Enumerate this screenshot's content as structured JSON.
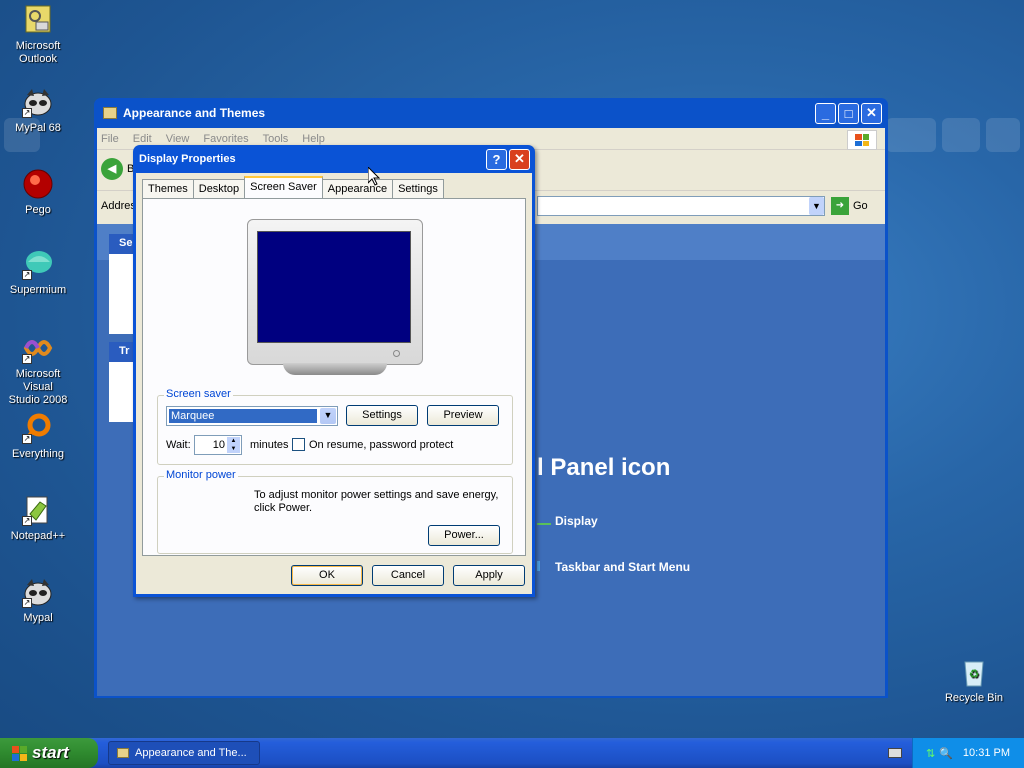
{
  "desktop": {
    "icons": [
      {
        "label": "Microsoft\nOutlook",
        "icon": "outlook-icon"
      },
      {
        "label": "MyPal 68",
        "icon": "mypal-icon"
      },
      {
        "label": "Pego",
        "icon": "pego-icon"
      },
      {
        "label": "Supermium",
        "icon": "supermium-icon"
      },
      {
        "label": "Microsoft Visual\nStudio 2008",
        "icon": "visual-studio-icon"
      },
      {
        "label": "Everything",
        "icon": "everything-icon"
      },
      {
        "label": "Notepad++",
        "icon": "notepadpp-icon"
      },
      {
        "label": "Mypal",
        "icon": "mypal-icon"
      }
    ],
    "recycle_bin": "Recycle Bin"
  },
  "explorer": {
    "title": "Appearance and Themes",
    "menu": [
      "File",
      "Edit",
      "View",
      "Favorites",
      "Tools",
      "Help"
    ],
    "address_label": "Addres",
    "back_label": "B",
    "go_label": "Go",
    "side_heading_1": "Se",
    "side_heading_2": "Tr",
    "heading": "l Panel icon",
    "links": [
      "Display",
      "Taskbar and Start Menu"
    ]
  },
  "dialog": {
    "title": "Display Properties",
    "help_glyph": "?",
    "close_glyph": "✕",
    "tabs": [
      "Themes",
      "Desktop",
      "Screen Saver",
      "Appearance",
      "Settings"
    ],
    "active_tab": "Screen Saver",
    "screen_saver": {
      "group_label": "Screen saver",
      "selected": "Marquee",
      "settings_button": "Settings",
      "preview_button": "Preview",
      "wait_label": "Wait:",
      "wait_value": "10",
      "minutes_label": "minutes",
      "password_checkbox_label": "On resume, password protect",
      "password_checked": false
    },
    "monitor_power": {
      "group_label": "Monitor power",
      "text": "To adjust monitor power settings and save energy, click Power.",
      "power_button": "Power..."
    },
    "ok_button": "OK",
    "cancel_button": "Cancel",
    "apply_button": "Apply"
  },
  "taskbar": {
    "start_label": "start",
    "task_label": "Appearance and The...",
    "clock": "10:31 PM"
  },
  "colors": {
    "xp_blue": "#0a53d6",
    "selection": "#316ac5",
    "monitor_screen": "#000080",
    "start_green": "#2f8a2f"
  }
}
